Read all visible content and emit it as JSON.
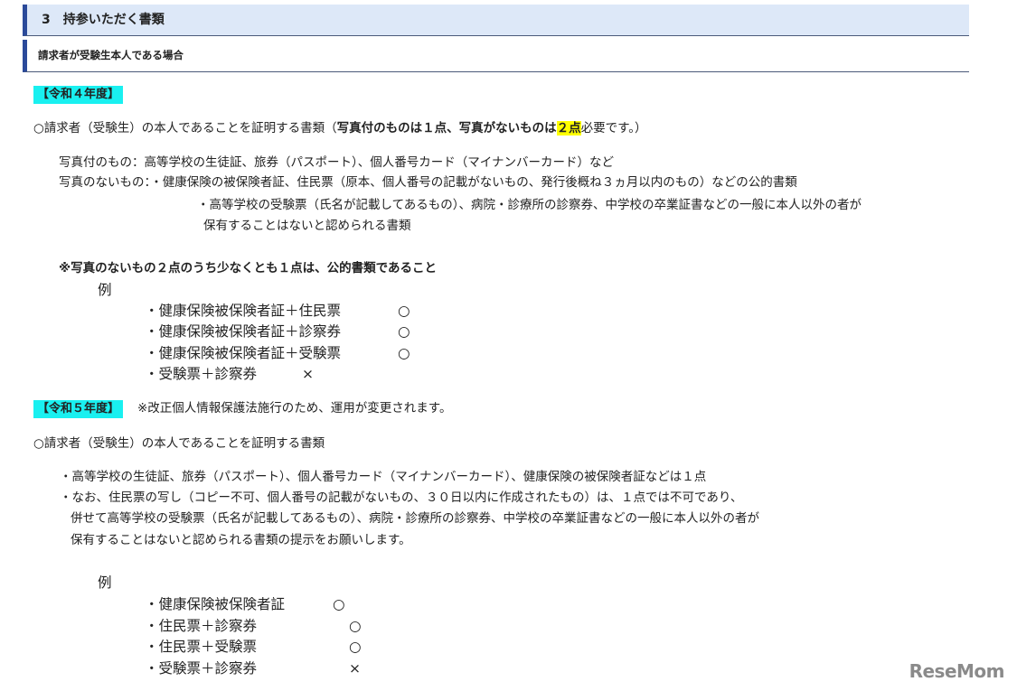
{
  "header": {
    "title": "3　持参いただく書類",
    "subtitle": "請求者が受験生本人である場合"
  },
  "r4": {
    "tag": "【令和４年度】",
    "lead_a": "○請求者（受験生）の本人であることを証明する書類（",
    "lead_b": "写真付のものは１点、写真がないものは",
    "lead_c": "２点",
    "lead_d": "必要です。）",
    "lines": [
      "写真付のもの：高等学校の生徒証、旅券（パスポート）、個人番号カード（マイナンバーカード）など",
      "写真のないもの：・健康保険の被保険者証、住民票（原本、個人番号の記載がないもの、発行後概ね３ヵ月以内のもの）などの公的書類",
      "・高等学校の受験票（氏名が記載してあるもの）、病院・診療所の診察券、中学校の卒業証書などの一般に本人以外の者が",
      "保有することはないと認められる書類"
    ],
    "note": "※写真のないもの２点のうち少なくとも１点は、公的書類であること",
    "example_label": "例",
    "examples": [
      {
        "text": "・健康保険被保険者証＋住民票",
        "mark": "○"
      },
      {
        "text": "・健康保険被保険者証＋診察券",
        "mark": "○"
      },
      {
        "text": "・健康保険被保険者証＋受験票",
        "mark": "○"
      },
      {
        "text": "・受験票＋診察券",
        "mark": "×"
      }
    ]
  },
  "r5": {
    "tag": "【令和５年度】",
    "tag_note": "※改正個人情報保護法施行のため、運用が変更されます。",
    "lead": "○請求者（受験生）の本人であることを証明する書類",
    "lines": [
      "・高等学校の生徒証、旅券（パスポート）、個人番号カード（マイナンバーカード）、健康保険の被保険者証などは１点",
      "・なお、住民票の写し（コピー不可、個人番号の記載がないもの、３０日以内に作成されたもの）は、１点では不可であり、",
      "併せて高等学校の受験票（氏名が記載してあるもの）、病院・診療所の診察券、中学校の卒業証書などの一般に本人以外の者が",
      "保有することはないと認められる書類の提示をお願いします。"
    ],
    "example_label": "例",
    "examples": [
      {
        "text": "・健康保険被保険者証",
        "mark": "○"
      },
      {
        "text": "・住民票＋診察券",
        "mark": "○"
      },
      {
        "text": "・住民票＋受験票",
        "mark": "○"
      },
      {
        "text": "・受験票＋診察券",
        "mark": "×"
      }
    ]
  },
  "logo": "ReseMom"
}
